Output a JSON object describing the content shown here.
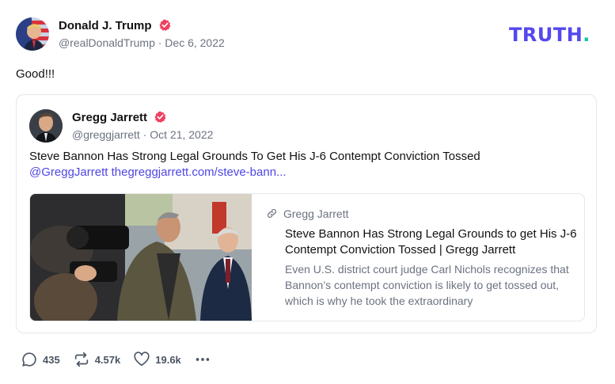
{
  "post": {
    "author_name": "Donald J. Trump",
    "handle_date": "@realDonaldTrump · Dec 6, 2022",
    "text": "Good!!!"
  },
  "brand": {
    "logo_text": "TRUTH",
    "logo_dot": "."
  },
  "quote": {
    "author_name": "Gregg Jarrett",
    "handle_date": "@greggjarrett · Oct 21, 2022",
    "text": "Steve Bannon Has Strong Legal Grounds To Get His J-6 Contempt Conviction Tossed",
    "links": "@GreggJarrett thegreggjarrett.com/steve-bann...",
    "link_card": {
      "site": "Gregg Jarrett",
      "title": "Steve Bannon Has Strong Legal Grounds to get His J-6 Contempt Conviction Tossed | Gregg Jarrett",
      "description": "Even U.S. district court judge Carl Nichols recognizes that Bannon’s contempt conviction is likely to get tossed out, which is why he took the extraordinary"
    }
  },
  "actions": {
    "replies": "435",
    "retruths": "4.57k",
    "likes": "19.6k"
  },
  "icons": [
    "verified-badge-icon",
    "link-icon",
    "reply-icon",
    "retruth-icon",
    "like-icon",
    "more-icon"
  ],
  "colors": {
    "brand": "#5448ee",
    "brand_dot": "#0fc5a6",
    "verified": "#ef4060",
    "link": "#4f46e5"
  }
}
